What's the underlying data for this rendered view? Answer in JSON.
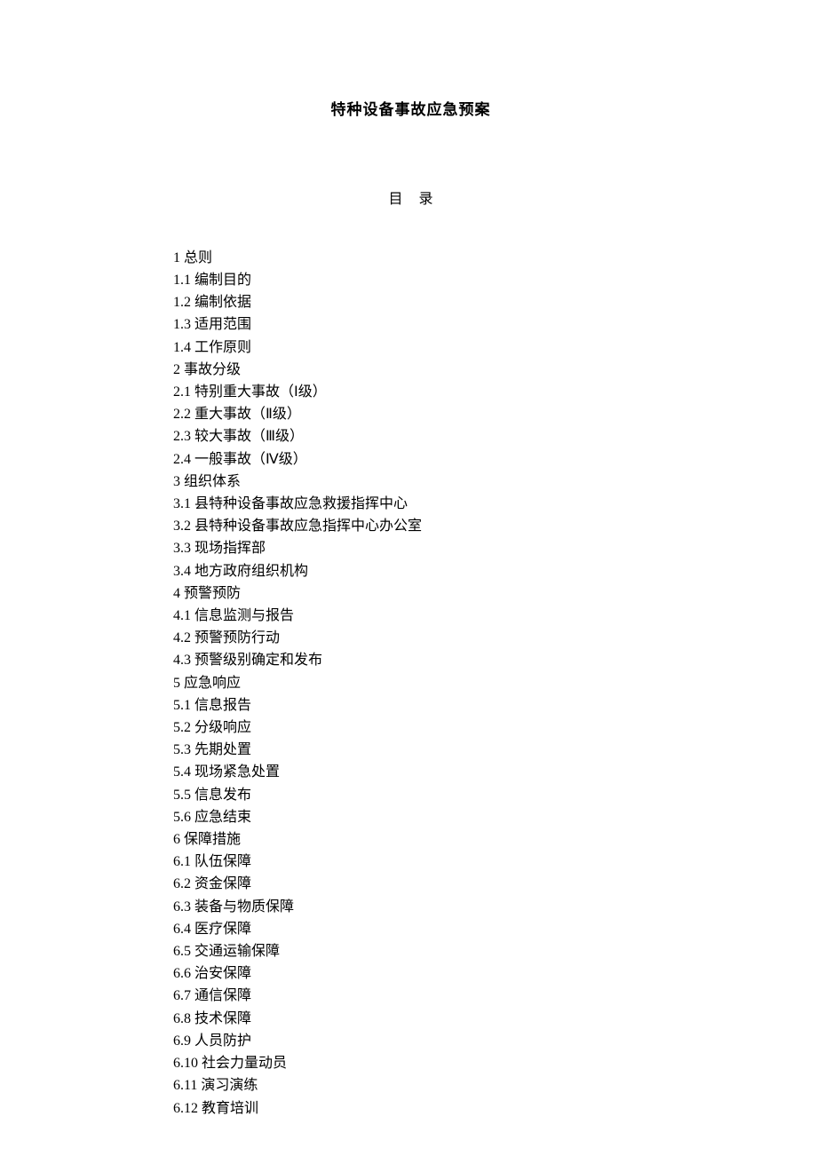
{
  "title": "特种设备事故应急预案",
  "toc_label": "目录",
  "toc": [
    {
      "num": "1",
      "text": "总则"
    },
    {
      "num": "1.1",
      "text": "编制目的"
    },
    {
      "num": "1.2",
      "text": "编制依据"
    },
    {
      "num": "1.3",
      "text": "适用范围"
    },
    {
      "num": "1.4",
      "text": "工作原则"
    },
    {
      "num": "2",
      "text": "事故分级"
    },
    {
      "num": "2.1",
      "text": "特别重大事故（Ⅰ级）"
    },
    {
      "num": "2.2",
      "text": "重大事故（Ⅱ级）"
    },
    {
      "num": "2.3",
      "text": "较大事故（Ⅲ级）"
    },
    {
      "num": "2.4",
      "text": "一般事故（Ⅳ级）"
    },
    {
      "num": "3",
      "text": "组织体系"
    },
    {
      "num": "3.1",
      "text": "县特种设备事故应急救援指挥中心"
    },
    {
      "num": "3.2",
      "text": "县特种设备事故应急指挥中心办公室"
    },
    {
      "num": "3.3",
      "text": "现场指挥部"
    },
    {
      "num": "3.4",
      "text": "地方政府组织机构"
    },
    {
      "num": "4",
      "text": "预警预防"
    },
    {
      "num": "4.1",
      "text": "信息监测与报告"
    },
    {
      "num": "4.2",
      "text": "预警预防行动"
    },
    {
      "num": "4.3",
      "text": "预警级别确定和发布"
    },
    {
      "num": "5",
      "text": "应急响应"
    },
    {
      "num": "5.1",
      "text": "信息报告"
    },
    {
      "num": "5.2",
      "text": "分级响应"
    },
    {
      "num": "5.3",
      "text": "先期处置"
    },
    {
      "num": "5.4",
      "text": "现场紧急处置"
    },
    {
      "num": "5.5",
      "text": "信息发布"
    },
    {
      "num": "5.6",
      "text": "应急结束"
    },
    {
      "num": "6",
      "text": "保障措施"
    },
    {
      "num": "6.1",
      "text": "队伍保障"
    },
    {
      "num": "6.2",
      "text": "资金保障"
    },
    {
      "num": "6.3",
      "text": "装备与物质保障"
    },
    {
      "num": "6.4",
      "text": "医疗保障"
    },
    {
      "num": "6.5",
      "text": "交通运输保障"
    },
    {
      "num": "6.6",
      "text": "治安保障"
    },
    {
      "num": "6.7",
      "text": "通信保障"
    },
    {
      "num": "6.8",
      "text": "技术保障"
    },
    {
      "num": "6.9",
      "text": "人员防护"
    },
    {
      "num": "6.10",
      "text": "社会力量动员"
    },
    {
      "num": "6.11",
      "text": "演习演练"
    },
    {
      "num": "6.12",
      "text": "教育培训"
    }
  ]
}
